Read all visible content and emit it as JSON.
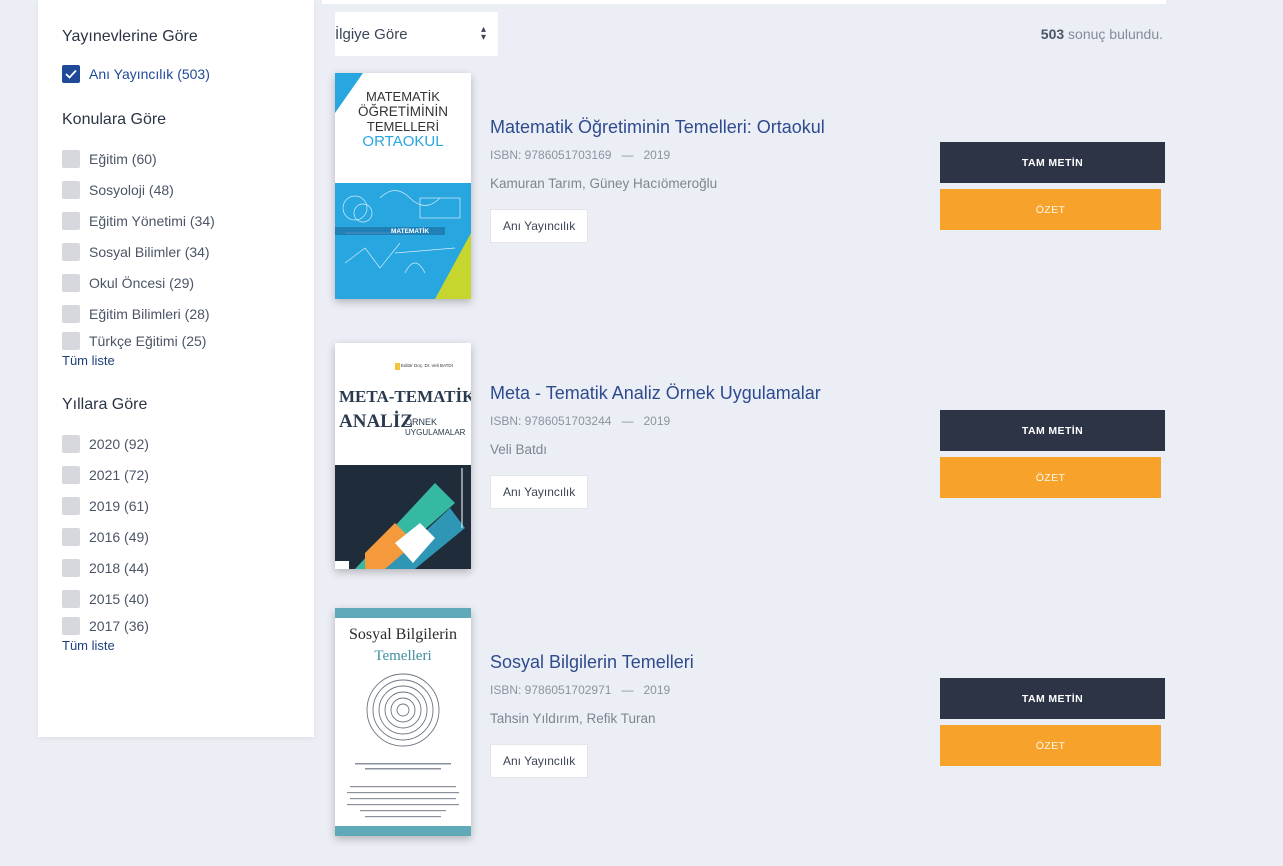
{
  "sidebar": {
    "publisher_facet": {
      "title": "Yayınevlerine Göre",
      "items": [
        {
          "label": "Anı Yayıncılık (503)",
          "checked": true
        }
      ]
    },
    "subject_facet": {
      "title": "Konulara Göre",
      "items": [
        {
          "label": "Eğitim (60)"
        },
        {
          "label": "Sosyoloji (48)"
        },
        {
          "label": "Eğitim Yönetimi (34)"
        },
        {
          "label": "Sosyal Bilimler (34)"
        },
        {
          "label": "Okul Öncesi (29)"
        },
        {
          "label": "Eğitim Bilimleri (28)"
        },
        {
          "label": "Türkçe Eğitimi (25)"
        }
      ],
      "all_link": "Tüm liste"
    },
    "year_facet": {
      "title": "Yıllara Göre",
      "items": [
        {
          "label": "2020 (92)"
        },
        {
          "label": "2021 (72)"
        },
        {
          "label": "2019 (61)"
        },
        {
          "label": "2016 (49)"
        },
        {
          "label": "2018 (44)"
        },
        {
          "label": "2015 (40)"
        },
        {
          "label": "2017 (36)"
        }
      ],
      "all_link": "Tüm liste"
    }
  },
  "toolbar": {
    "sort_value": "İlgiye Göre",
    "result_count": "503",
    "result_suffix": "sonuç bulundu."
  },
  "books": [
    {
      "title": "Matematik Öğretiminin Temelleri: Ortaokul",
      "isbn": "ISBN: 9786051703169",
      "year": "2019",
      "authors": "Kamuran Tarım, Güney Hacıömeroğlu",
      "publisher": "Anı Yayıncılık",
      "full_text_label": "TAM METİN",
      "abstract_label": "ÖZET",
      "cover": {
        "line1": "MATEMATİK",
        "line2": "ÖĞRETİMİNİN",
        "line3": "TEMELLERİ",
        "line4": "ORTAOKUL",
        "band": "MATEMATİK"
      }
    },
    {
      "title": "Meta - Tematik Analiz Örnek Uygulamalar",
      "isbn": "ISBN: 9786051703244",
      "year": "2019",
      "authors": "Veli Batdı",
      "publisher": "Anı Yayıncılık",
      "full_text_label": "TAM METİN",
      "abstract_label": "ÖZET",
      "cover": {
        "editor": "Editör Doç. Dr. Veli BATDI",
        "line1": "META-TEMATİK",
        "line2": "ANALİZ",
        "line3": "ÖRNEK",
        "line4": "UYGULAMALAR"
      }
    },
    {
      "title": "Sosyal Bilgilerin Temelleri",
      "isbn": "ISBN: 9786051702971",
      "year": "2019",
      "authors": "Tahsin Yıldırım, Refik Turan",
      "publisher": "Anı Yayıncılık",
      "full_text_label": "TAM METİN",
      "abstract_label": "ÖZET",
      "cover": {
        "line1": "Sosyal Bilgilerin",
        "line2": "Temelleri"
      }
    }
  ],
  "colors": {
    "accent_blue": "#2e4b8f",
    "dark_button": "#2d3446",
    "orange_button": "#f6a22b",
    "background": "#eceef5"
  }
}
